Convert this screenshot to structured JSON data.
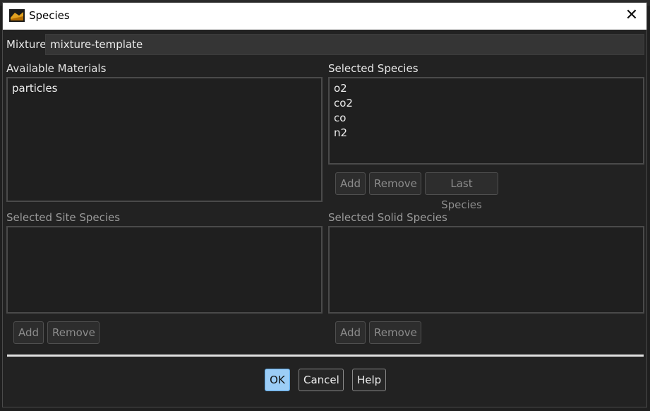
{
  "window": {
    "title": "Species",
    "close_glyph": "✕"
  },
  "mixture": {
    "label": "Mixture",
    "value": "mixture-template"
  },
  "available_materials": {
    "label": "Available Materials",
    "items": [
      "particles"
    ]
  },
  "selected_species": {
    "label": "Selected Species",
    "items": [
      "o2",
      "co2",
      "co",
      "n2"
    ],
    "buttons": {
      "add": "Add",
      "remove": "Remove",
      "last_species": "Last Species"
    }
  },
  "selected_site_species": {
    "label": "Selected Site Species",
    "items": [],
    "buttons": {
      "add": "Add",
      "remove": "Remove"
    }
  },
  "selected_solid_species": {
    "label": "Selected Solid Species",
    "items": [],
    "buttons": {
      "add": "Add",
      "remove": "Remove"
    }
  },
  "footer": {
    "ok": "OK",
    "cancel": "Cancel",
    "help": "Help"
  },
  "colors": {
    "accent_ok": "#9ccdf6",
    "dialog_bg": "#222222",
    "titlebar_bg": "#ffffff"
  }
}
